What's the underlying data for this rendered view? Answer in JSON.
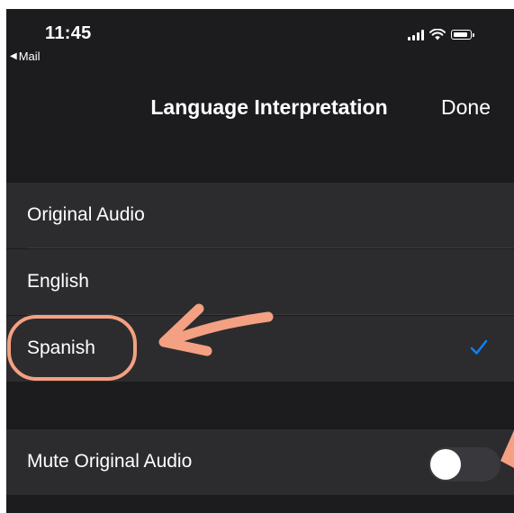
{
  "status_bar": {
    "time": "11:45",
    "back_label": "Mail"
  },
  "nav": {
    "title": "Language Interpretation",
    "done_label": "Done"
  },
  "languages": [
    {
      "label": "Original Audio",
      "selected": false
    },
    {
      "label": "English",
      "selected": false
    },
    {
      "label": "Spanish",
      "selected": true
    }
  ],
  "mute": {
    "label": "Mute Original Audio",
    "enabled": false
  },
  "colors": {
    "background": "#1c1c1e",
    "row": "#2c2c2e",
    "accent": "#0a84ff",
    "annotation": "#f4a082"
  },
  "icons": [
    "signal-icon",
    "wifi-icon",
    "battery-icon",
    "checkmark-icon",
    "arrow-annotation"
  ]
}
